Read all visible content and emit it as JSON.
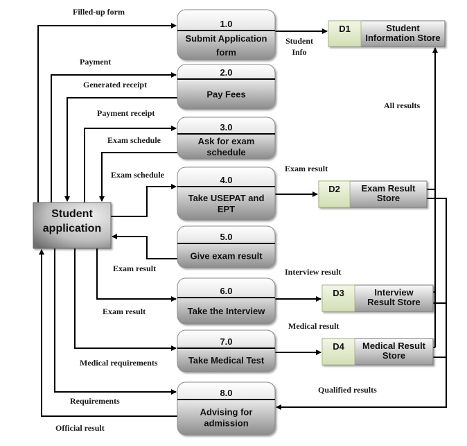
{
  "diagram": {
    "type": "data-flow-diagram",
    "external_entity": {
      "id": "student-application",
      "lines": [
        "Student",
        "application"
      ]
    },
    "processes": [
      {
        "id": "1.0",
        "lines": [
          "Submit Application",
          "form"
        ]
      },
      {
        "id": "2.0",
        "lines": [
          "Pay Fees"
        ]
      },
      {
        "id": "3.0",
        "lines": [
          "Ask for exam",
          "schedule"
        ]
      },
      {
        "id": "4.0",
        "lines": [
          "Take USEPAT and",
          "EPT"
        ]
      },
      {
        "id": "5.0",
        "lines": [
          "Give exam result"
        ]
      },
      {
        "id": "6.0",
        "lines": [
          "Take the Interview"
        ]
      },
      {
        "id": "7.0",
        "lines": [
          "Take Medical Test"
        ]
      },
      {
        "id": "8.0",
        "lines": [
          "Advising for",
          "admission"
        ]
      }
    ],
    "data_stores": [
      {
        "id": "D1",
        "lines": [
          "Student",
          "Information Store"
        ]
      },
      {
        "id": "D2",
        "lines": [
          "Exam Result",
          "Store"
        ]
      },
      {
        "id": "D3",
        "lines": [
          "Interview",
          "Result Store"
        ]
      },
      {
        "id": "D4",
        "lines": [
          "Medical Result",
          "Store"
        ]
      }
    ],
    "flows": [
      {
        "from": "Student application",
        "to": "1.0",
        "label": "Filled-up form"
      },
      {
        "from": "Student application",
        "to": "2.0",
        "label": "Payment"
      },
      {
        "from": "2.0",
        "to": "Student application",
        "label": "Generated receipt"
      },
      {
        "from": "Student application",
        "to": "3.0",
        "label": "Payment receipt"
      },
      {
        "from": "3.0",
        "to": "Student application",
        "label": "Exam schedule"
      },
      {
        "from": "Student application",
        "to": "4.0",
        "label": "Exam schedule"
      },
      {
        "from": "5.0",
        "to": "Student application",
        "label": "Exam result"
      },
      {
        "from": "Student application",
        "to": "6.0",
        "label": "Exam result"
      },
      {
        "from": "Student application",
        "to": "7.0",
        "label": "Medical requirements"
      },
      {
        "from": "Student application",
        "to": "8.0",
        "label": "Requirements"
      },
      {
        "from": "8.0",
        "to": "Student application",
        "label": "Official result"
      },
      {
        "from": "1.0",
        "to": "D1",
        "label": "Student Info"
      },
      {
        "from": "4.0",
        "to": "D2",
        "label": "Exam result"
      },
      {
        "from": "6.0",
        "to": "D3",
        "label": "Interview result"
      },
      {
        "from": "7.0",
        "to": "D4",
        "label": "Medical result"
      },
      {
        "from": "D2/D3/D4",
        "to": "D1",
        "label": "All results"
      },
      {
        "from": "D2/D3/D4",
        "to": "8.0",
        "label": "Qualified results"
      }
    ]
  },
  "colors": {
    "line": "#000000",
    "process_top": "#ffffff",
    "process_bottom": "#8a8a8a",
    "store_id_fill": "#e4ecd0",
    "store_body_top": "#f2f2f2",
    "store_body_bottom": "#9a9a9a",
    "entity_dark": "#777777",
    "entity_light": "#e0e0e0"
  }
}
